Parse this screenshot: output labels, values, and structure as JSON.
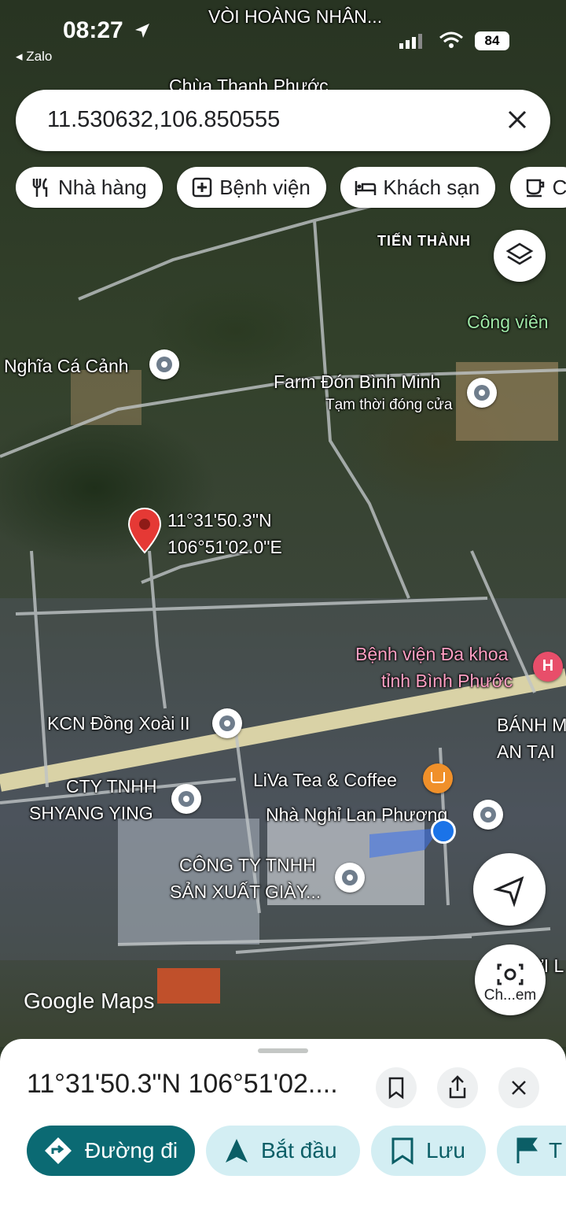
{
  "status_bar": {
    "time": "08:27",
    "back_app": "Zalo",
    "battery": "84"
  },
  "search": {
    "query": "11.530632,106.850555"
  },
  "chips": [
    {
      "icon": "fork-knife-icon",
      "label": "Nhà hàng"
    },
    {
      "icon": "hospital-plus-icon",
      "label": "Bệnh viện"
    },
    {
      "icon": "bed-icon",
      "label": "Khách sạn"
    },
    {
      "icon": "coffee-cup-icon",
      "label": "C"
    }
  ],
  "map": {
    "labels": {
      "voi_hoang_nhan": "VÒI HOÀNG NHÂN...",
      "chua_thanh_phuoc": "Chùa Thanh Phước",
      "tien_thanh": "TIẾN THÀNH",
      "cong_vien": "Công viên",
      "nghia_ca_canh": "Nghĩa Cá Cảnh",
      "farm": "Farm Đón Bình Minh",
      "farm_status": "Tạm thời đóng cửa",
      "pin_lat": "11°31'50.3\"N",
      "pin_lng": "106°51'02.0\"E",
      "hospital_1": "Bệnh viện Đa khoa",
      "hospital_2": "tỉnh Bình Phước",
      "kcn": "KCN Đồng Xoài II",
      "banh_1": "BÁNH M",
      "banh_2": "AN TẠI",
      "cty_1": "CTY TNHH",
      "cty_2": "SHYANG YING",
      "liva": "LiVa Tea & Coffee",
      "nha_nghi": "Nhà Nghỉ Lan Phương",
      "cong_ty_1": "CÔNG TY TNHH",
      "cong_ty_2": "SẢN XUẤT GIÀY...",
      "loi": "ỜI L"
    },
    "camera_label": "Ch...em",
    "attribution": "Google Maps"
  },
  "sheet": {
    "title": "11°31'50.3\"N 106°51'02....",
    "actions": [
      {
        "icon": "directions-icon",
        "label": "Đường đi"
      },
      {
        "icon": "navigation-arrow-icon",
        "label": "Bắt đầu"
      },
      {
        "icon": "bookmark-icon",
        "label": "Lưu"
      },
      {
        "icon": "flag-icon",
        "label": "T"
      }
    ]
  },
  "colors": {
    "accent": "#0b6a73",
    "pin": "#e53935",
    "my_location": "#1a73e8"
  }
}
